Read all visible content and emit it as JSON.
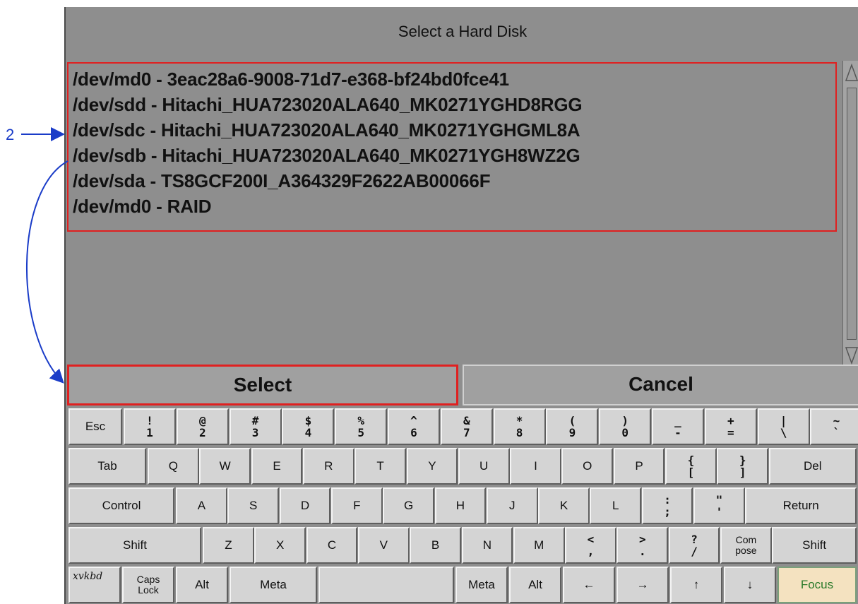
{
  "dialog": {
    "title": "Select a Hard Disk",
    "disks": [
      "/dev/md0 - 3eac28a6-9008-71d7-e368-bf24bd0fce41",
      "/dev/sdd - Hitachi_HUA723020ALA640_MK0271YGHD8RGG",
      "/dev/sdc - Hitachi_HUA723020ALA640_MK0271YGHGML8A",
      "/dev/sdb - Hitachi_HUA723020ALA640_MK0271YGH8WZ2G",
      "/dev/sda - TS8GCF200I_A364329F2622AB00066F",
      "/dev/md0 - RAID"
    ],
    "select_label": "Select",
    "cancel_label": "Cancel"
  },
  "annotation": {
    "number": "2"
  },
  "keyboard": {
    "row1": [
      {
        "t": "Esc"
      },
      {
        "t": "!",
        "b": "1"
      },
      {
        "t": "@",
        "b": "2"
      },
      {
        "t": "#",
        "b": "3"
      },
      {
        "t": "$",
        "b": "4"
      },
      {
        "t": "%",
        "b": "5"
      },
      {
        "t": "^",
        "b": "6"
      },
      {
        "t": "&",
        "b": "7"
      },
      {
        "t": "*",
        "b": "8"
      },
      {
        "t": "(",
        "b": "9"
      },
      {
        "t": ")",
        "b": "0"
      },
      {
        "t": "_",
        "b": "-"
      },
      {
        "t": "+",
        "b": "="
      },
      {
        "t": "|",
        "b": "\\"
      },
      {
        "t": "~",
        "b": "`"
      }
    ],
    "row2": [
      "Tab",
      "Q",
      "W",
      "E",
      "R",
      "T",
      "Y",
      "U",
      "I",
      "O",
      "P",
      {
        "t": "{",
        "b": "["
      },
      {
        "t": "}",
        "b": "]"
      },
      "Del"
    ],
    "row3": [
      "Control",
      "A",
      "S",
      "D",
      "F",
      "G",
      "H",
      "J",
      "K",
      "L",
      {
        "t": ":",
        "b": ";"
      },
      {
        "t": "\"",
        "b": "'"
      },
      "Return"
    ],
    "row4": [
      "Shift",
      "Z",
      "X",
      "C",
      "V",
      "B",
      "N",
      "M",
      {
        "t": "<",
        "b": ","
      },
      {
        "t": ">",
        "b": "."
      },
      {
        "t": "?",
        "b": "/"
      },
      {
        "t": "Com",
        "b": "pose"
      },
      "Shift"
    ],
    "row5": [
      {
        "t": "Caps",
        "b": "Lock"
      },
      "Alt",
      "Meta",
      "",
      "Meta",
      "Alt",
      "←",
      "→",
      "↑",
      "↓",
      "Focus"
    ],
    "logo": "xvkbd"
  },
  "colors": {
    "highlight": "#e02020",
    "annotation": "#1a3cc8",
    "focus_bg": "#f4e2c0"
  }
}
